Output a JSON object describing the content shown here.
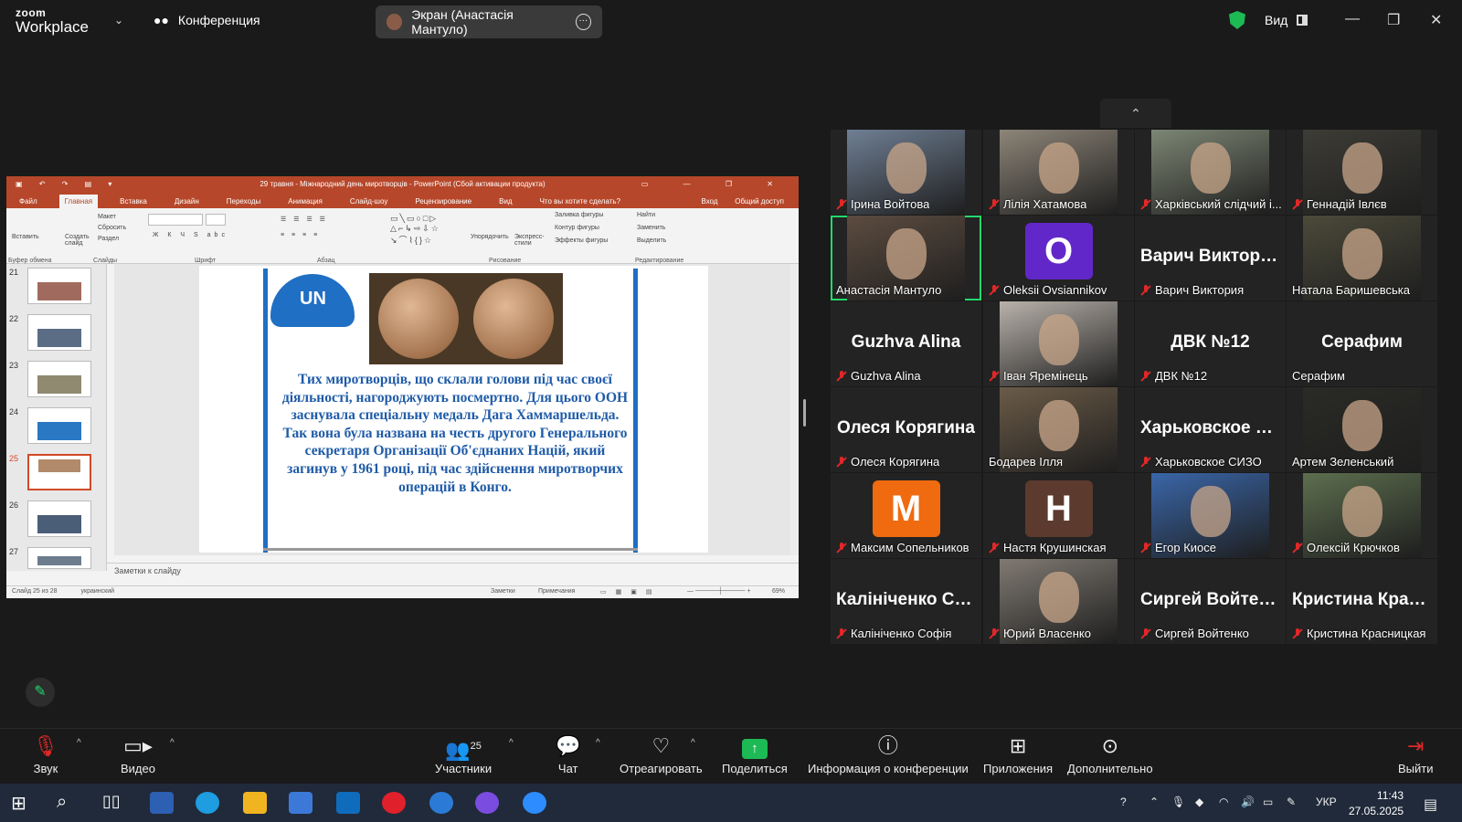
{
  "topbar": {
    "logo_line1": "zoom",
    "logo_line2": "Workplace",
    "meeting_label": "Конференция",
    "screen_share_label": "Экран (Анастасія Мантуло)",
    "view_label": "Вид"
  },
  "shared_screen": {
    "window_title": "29 травня - Міжнародний день миротворців - PowerPoint (Сбой активации продукта)",
    "ribbon_tabs": [
      "Файл",
      "Главная",
      "Вставка",
      "Дизайн",
      "Переходы",
      "Анимация",
      "Слайд-шоу",
      "Рецензирование",
      "Вид"
    ],
    "tell_me": "Что вы хотите сделать?",
    "sign_in": "Вход",
    "share_access": "Общий доступ",
    "ribbon_groups": {
      "clipboard": "Буфер обмена",
      "slides": "Слайды",
      "font": "Шрифт",
      "paragraph": "Абзац",
      "drawing": "Рисование",
      "editing": "Редактирование"
    },
    "ribbon_items": {
      "paste": "Вставить",
      "layout": "Макет",
      "reset": "Сбросить",
      "section": "Раздел",
      "new_slide": "Создать слайд",
      "arrange": "Упорядочить",
      "quick_styles": "Экспресс-стили",
      "shape_fill": "Заливка фигуры",
      "shape_outline": "Контур фигуры",
      "shape_effects": "Эффекты фигуры",
      "find": "Найти",
      "replace": "Заменить",
      "select": "Выделить"
    },
    "thumb_numbers": [
      "21",
      "22",
      "23",
      "24",
      "25",
      "26",
      "27"
    ],
    "slide_logo": "UN",
    "slide_text": "Тих миротворців, що склали голови під час своєї діяльності, нагороджують посмертно. Для цього ООН заснувала спеціальну медаль Дага Хаммаршельда. Так вона була названа на честь другого Генерального секретаря Організації Об'єднаних Націй, який загинув у 1961 році, під час здійснення миротворчих операцій в Конго.",
    "notes_placeholder": "Заметки к слайду",
    "status_slide": "Слайд 25 из 28",
    "status_lang": "украинский",
    "status_notes": "Заметки",
    "status_comments": "Примечания",
    "zoom_level": "69%"
  },
  "participants": [
    {
      "name": "Ірина Войтова",
      "muted": true,
      "type": "video",
      "color": "#6f7f94"
    },
    {
      "name": "Лілія Хатамова",
      "muted": true,
      "type": "video",
      "color": "#8d8578"
    },
    {
      "name": "Харківський слідчий і...",
      "muted": true,
      "type": "video",
      "color": "#7d8674"
    },
    {
      "name": "Геннадій Івлєв",
      "muted": true,
      "type": "video",
      "color": "#3d3c36"
    },
    {
      "name": "Анастасія Мантуло",
      "muted": false,
      "type": "video",
      "color": "#5c4c40",
      "active": true
    },
    {
      "name": "Oleksii Ovsiannikov",
      "muted": true,
      "type": "letter",
      "letter": "O",
      "color": "#6227c9"
    },
    {
      "name": "Варич Виктория",
      "muted": true,
      "type": "name",
      "bigname": "Варич Виктория"
    },
    {
      "name": "Натала Баришевська",
      "muted": false,
      "type": "video",
      "color": "#4c4a3a"
    },
    {
      "name": "Guzhva Alina",
      "muted": true,
      "type": "name",
      "bigname": "Guzhva Alina"
    },
    {
      "name": "Іван Яремінець",
      "muted": true,
      "type": "video",
      "color": "#b9b2ab"
    },
    {
      "name": "ДВК №12",
      "muted": true,
      "type": "name",
      "bigname": "ДВК №12"
    },
    {
      "name": "Серафим",
      "muted": false,
      "type": "name",
      "bigname": "Серафим"
    },
    {
      "name": "Олеся Корягина",
      "muted": true,
      "type": "name",
      "bigname": "Олеся Корягина"
    },
    {
      "name": "Бодарев Ілля",
      "muted": false,
      "type": "video",
      "color": "#6b5b48"
    },
    {
      "name": "Харьковское СИЗО",
      "muted": true,
      "type": "name",
      "bigname": "Харьковское С..."
    },
    {
      "name": "Артем Зеленський",
      "muted": false,
      "type": "video",
      "color": "#2a2a26"
    },
    {
      "name": "Максим Сопельников",
      "muted": true,
      "type": "letter",
      "letter": "M",
      "color": "#f06a0f"
    },
    {
      "name": "Настя Крушинская",
      "muted": true,
      "type": "letter",
      "letter": "H",
      "color": "#5c3b2e"
    },
    {
      "name": "Егор Киосе",
      "muted": true,
      "type": "video",
      "color": "#3a66a8"
    },
    {
      "name": "Олексій Крючков",
      "muted": true,
      "type": "video",
      "color": "#5d6f4f"
    },
    {
      "name": "Калініченко Софія",
      "muted": true,
      "type": "name",
      "bigname": "Калініченко Со..."
    },
    {
      "name": "Юрий Власенко",
      "muted": true,
      "type": "video",
      "color": "#807a72"
    },
    {
      "name": "Сиргей Войтенко",
      "muted": true,
      "type": "name",
      "bigname": "Сиргей Войтенко"
    },
    {
      "name": "Кристина Красницкая",
      "muted": true,
      "type": "name",
      "bigname": "Кристина Крас..."
    }
  ],
  "toolbar": {
    "audio": "Звук",
    "video": "Видео",
    "participants": "Участники",
    "participants_count": "25",
    "chat": "Чат",
    "react": "Отреагировать",
    "share": "Поделиться",
    "info": "Информация о конференции",
    "apps": "Приложения",
    "more": "Дополнительно",
    "leave": "Выйти"
  },
  "taskbar": {
    "lang": "УКР",
    "time": "11:43",
    "date": "27.05.2025"
  },
  "colors": {
    "accent_green": "#23d96c",
    "ppt_red": "#b7472a",
    "slide_blue": "#1f5ba8"
  }
}
